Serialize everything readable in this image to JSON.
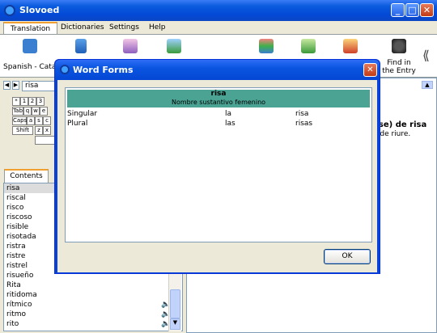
{
  "window": {
    "title": "Slovoed"
  },
  "menu": {
    "tabs": [
      "Translation",
      "Dictionaries",
      "Settings",
      "Help"
    ]
  },
  "toolbar": {
    "direction_label": "Spanish - Catalan",
    "find_label": "Find in the Entry",
    "collapse_glyph": "⟪"
  },
  "search": {
    "value": "risa"
  },
  "keyboard": {
    "row1": [
      "*",
      "1",
      "2",
      "3"
    ],
    "row2": [
      "Tab",
      "q",
      "w",
      "e"
    ],
    "row3": [
      "Caps",
      "a",
      "s",
      "c"
    ],
    "row4": [
      "Shift",
      "z",
      "x"
    ]
  },
  "contents": {
    "tab_label": "Contents",
    "items": [
      "risa",
      "riscal",
      "risco",
      "riscoso",
      "risible",
      "risotada",
      "ristra",
      "ristre",
      "ristrel",
      "risueño",
      "Rita",
      "ritidoma",
      "rítmico",
      "ritmo",
      "rito"
    ],
    "speaker_rows": [
      12,
      13,
      14
    ]
  },
  "article": {
    "heading": "rse) de risa",
    "text": ") de riure."
  },
  "dialog": {
    "title": "Word Forms",
    "word": "risa",
    "pos": "Nombre sustantivo femenino",
    "rows": [
      {
        "form": "Singular",
        "article": "la",
        "word": "risa"
      },
      {
        "form": "Plural",
        "article": "las",
        "word": "risas"
      }
    ],
    "ok_label": "OK"
  }
}
